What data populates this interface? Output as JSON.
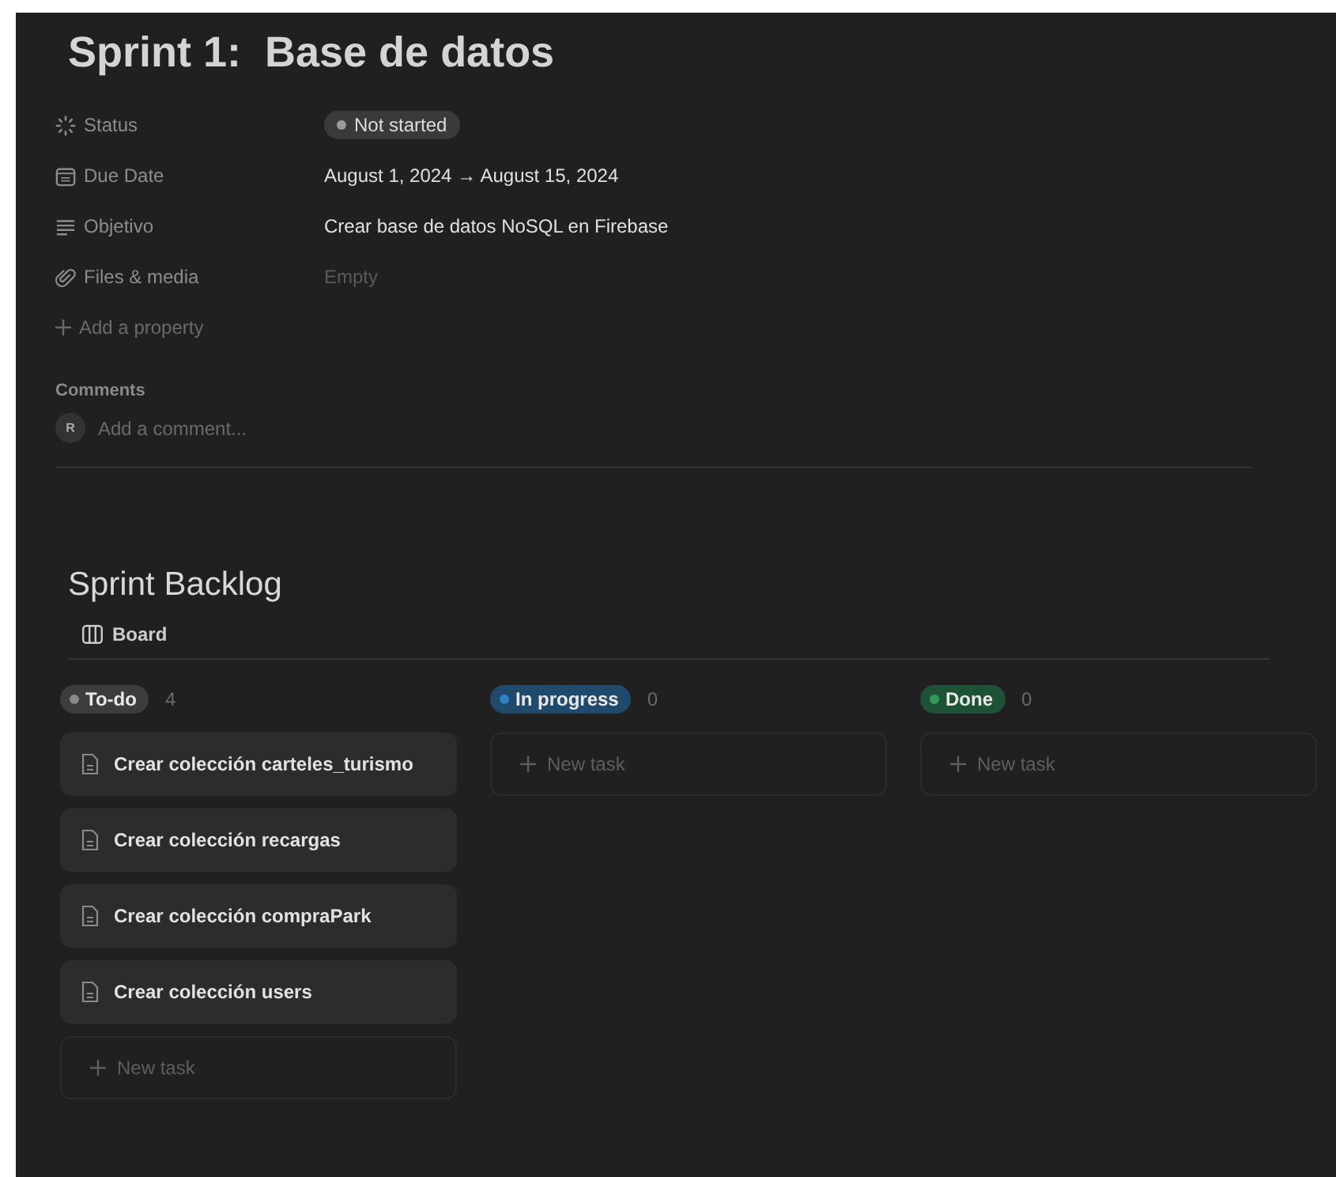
{
  "page": {
    "title": "Sprint 1:  Base de datos"
  },
  "properties": [
    {
      "kind": "status",
      "label": "Status",
      "value": "Not started"
    },
    {
      "kind": "date",
      "label": "Due Date",
      "value": "August 1, 2024 → August 15, 2024"
    },
    {
      "kind": "text",
      "label": "Objetivo",
      "value": "Crear base de datos NoSQL en Firebase"
    },
    {
      "kind": "files",
      "label": "Files & media",
      "value": "Empty"
    }
  ],
  "add_property": "Add a property",
  "comments": {
    "heading": "Comments",
    "avatar": "R",
    "placeholder": "Add a comment..."
  },
  "backlog": {
    "title": "Sprint Backlog",
    "view": "Board",
    "columns": [
      {
        "label": "To-do",
        "count": "4",
        "color": "#8a8a8a",
        "cards": [
          "Crear colección carteles_turismo",
          "Crear colección recargas",
          "Crear colección compraPark",
          "Crear colección users"
        ],
        "new_task": "New task"
      },
      {
        "label": "In progress",
        "count": "0",
        "color": "#2f80c7",
        "new_task": "New task"
      },
      {
        "label": "Done",
        "count": "0",
        "color": "#2f9a5c",
        "new_task": "New task"
      }
    ]
  }
}
